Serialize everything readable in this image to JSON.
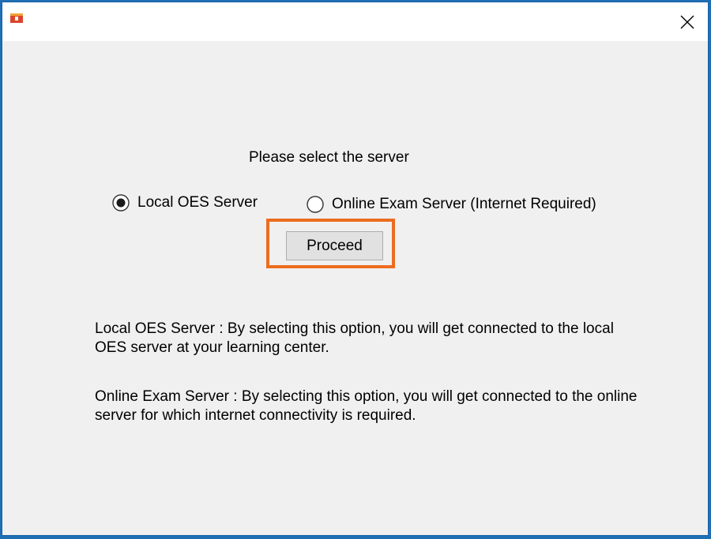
{
  "dialog": {
    "prompt": "Please select the server",
    "options": [
      {
        "label": "Local OES Server",
        "selected": true
      },
      {
        "label": "Online Exam Server (Internet Required)",
        "selected": false
      }
    ],
    "proceed_label": "Proceed",
    "descriptions": {
      "local": "Local OES Server : By selecting this option, you will get connected to the local OES server at your learning center.",
      "online": "Online Exam Server : By selecting this option, you will get connected to the online server for which internet connectivity is required."
    }
  },
  "colors": {
    "highlight": "#ec6d1f",
    "window_border": "#1a62a8"
  }
}
